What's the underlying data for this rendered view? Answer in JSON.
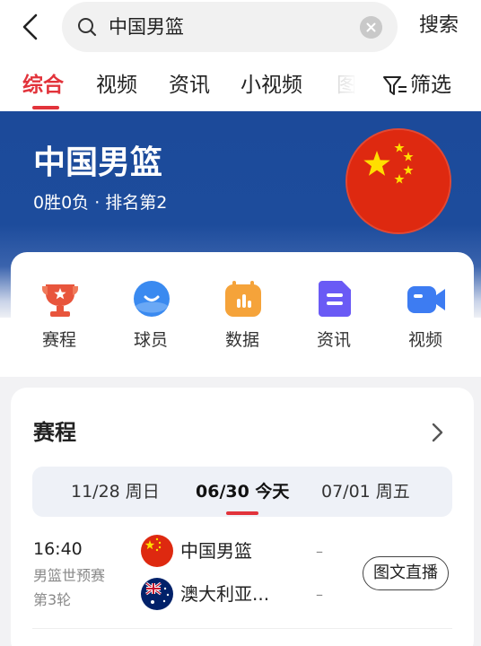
{
  "search": {
    "query": "中国男篮",
    "button_label": "搜索"
  },
  "tabs": [
    {
      "label": "综合",
      "active": true
    },
    {
      "label": "视频"
    },
    {
      "label": "资讯"
    },
    {
      "label": "小视频"
    },
    {
      "label": "图"
    }
  ],
  "filter_label": "筛选",
  "hero": {
    "team_name": "中国男篮",
    "record": "0胜0负 · 排名第2"
  },
  "quick_nav": [
    {
      "label": "赛程",
      "icon": "trophy-icon",
      "color": "#e8553c"
    },
    {
      "label": "球员",
      "icon": "player-icon",
      "color": "#3a8af0"
    },
    {
      "label": "数据",
      "icon": "stats-icon",
      "color": "#f5a33a"
    },
    {
      "label": "资讯",
      "icon": "news-icon",
      "color": "#6a5af5"
    },
    {
      "label": "视频",
      "icon": "video-icon",
      "color": "#3d7cf2"
    }
  ],
  "schedule": {
    "title": "赛程",
    "dates": [
      {
        "label": "11/28 周日"
      },
      {
        "label": "06/30 今天",
        "active": true
      },
      {
        "label": "07/01 周五"
      }
    ],
    "match": {
      "time": "16:40",
      "stage": "男篮世预赛",
      "round": "第3轮",
      "home": {
        "name": "中国男篮",
        "score": "–"
      },
      "away": {
        "name": "澳大利亚...",
        "score": "–"
      },
      "action": "图文直播"
    }
  },
  "colors": {
    "accent": "#e2333b",
    "hero_bg": "#1d4c9c"
  }
}
